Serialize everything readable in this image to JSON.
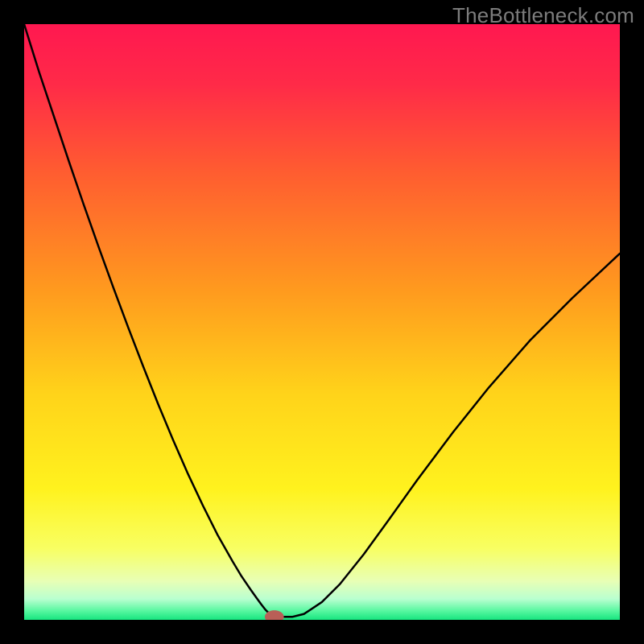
{
  "watermark": "TheBottleneck.com",
  "chart_data": {
    "type": "line",
    "title": "",
    "xlabel": "",
    "ylabel": "",
    "xlim": [
      0,
      100
    ],
    "ylim": [
      0,
      100
    ],
    "grid": false,
    "legend": false,
    "background_gradient_stops": [
      {
        "pos": 0.0,
        "color": "#ff1850"
      },
      {
        "pos": 0.1,
        "color": "#ff2a48"
      },
      {
        "pos": 0.25,
        "color": "#ff5d30"
      },
      {
        "pos": 0.45,
        "color": "#ff9b1e"
      },
      {
        "pos": 0.62,
        "color": "#ffd31a"
      },
      {
        "pos": 0.78,
        "color": "#fff21e"
      },
      {
        "pos": 0.88,
        "color": "#f8ff62"
      },
      {
        "pos": 0.935,
        "color": "#e8ffb5"
      },
      {
        "pos": 0.965,
        "color": "#b9ffd0"
      },
      {
        "pos": 0.985,
        "color": "#57f7a0"
      },
      {
        "pos": 1.0,
        "color": "#17e57f"
      }
    ],
    "series": [
      {
        "name": "bottleneck-curve",
        "stroke": "#000000",
        "stroke_width": 2.5,
        "x": [
          0.0,
          2.5,
          5.0,
          7.5,
          10.0,
          12.5,
          15.0,
          17.5,
          20.0,
          22.5,
          25.0,
          27.5,
          30.0,
          32.5,
          35.0,
          36.5,
          38.0,
          39.0,
          39.8,
          40.5,
          41.2,
          43.5,
          45.0,
          47.0,
          50.0,
          53.0,
          57.0,
          61.0,
          66.0,
          72.0,
          78.0,
          85.0,
          92.0,
          100.0
        ],
        "y": [
          100.0,
          92.0,
          84.5,
          77.0,
          69.7,
          62.6,
          55.7,
          49.0,
          42.5,
          36.2,
          30.2,
          24.5,
          19.2,
          14.2,
          9.8,
          7.3,
          5.1,
          3.7,
          2.6,
          1.7,
          1.0,
          0.5,
          0.5,
          1.0,
          3.0,
          6.0,
          11.0,
          16.5,
          23.5,
          31.5,
          39.0,
          47.0,
          54.0,
          61.5
        ]
      }
    ],
    "marker": {
      "name": "optimal-point",
      "cx": 42.0,
      "cy": 0.5,
      "rx": 1.6,
      "ry": 1.1,
      "fill": "#b95f57"
    }
  }
}
